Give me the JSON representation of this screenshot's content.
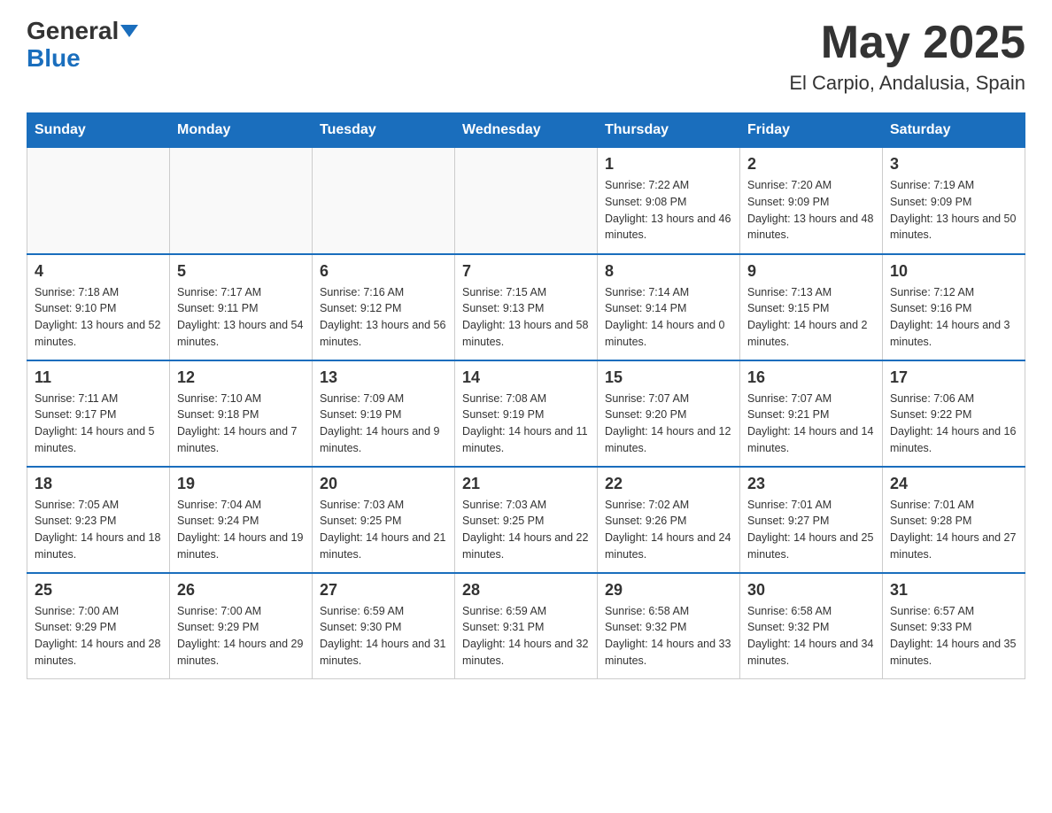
{
  "header": {
    "logo_general": "General",
    "logo_blue": "Blue",
    "month_title": "May 2025",
    "location": "El Carpio, Andalusia, Spain"
  },
  "days_of_week": [
    "Sunday",
    "Monday",
    "Tuesday",
    "Wednesday",
    "Thursday",
    "Friday",
    "Saturday"
  ],
  "weeks": [
    [
      {
        "day": "",
        "info": ""
      },
      {
        "day": "",
        "info": ""
      },
      {
        "day": "",
        "info": ""
      },
      {
        "day": "",
        "info": ""
      },
      {
        "day": "1",
        "info": "Sunrise: 7:22 AM\nSunset: 9:08 PM\nDaylight: 13 hours and 46 minutes."
      },
      {
        "day": "2",
        "info": "Sunrise: 7:20 AM\nSunset: 9:09 PM\nDaylight: 13 hours and 48 minutes."
      },
      {
        "day": "3",
        "info": "Sunrise: 7:19 AM\nSunset: 9:09 PM\nDaylight: 13 hours and 50 minutes."
      }
    ],
    [
      {
        "day": "4",
        "info": "Sunrise: 7:18 AM\nSunset: 9:10 PM\nDaylight: 13 hours and 52 minutes."
      },
      {
        "day": "5",
        "info": "Sunrise: 7:17 AM\nSunset: 9:11 PM\nDaylight: 13 hours and 54 minutes."
      },
      {
        "day": "6",
        "info": "Sunrise: 7:16 AM\nSunset: 9:12 PM\nDaylight: 13 hours and 56 minutes."
      },
      {
        "day": "7",
        "info": "Sunrise: 7:15 AM\nSunset: 9:13 PM\nDaylight: 13 hours and 58 minutes."
      },
      {
        "day": "8",
        "info": "Sunrise: 7:14 AM\nSunset: 9:14 PM\nDaylight: 14 hours and 0 minutes."
      },
      {
        "day": "9",
        "info": "Sunrise: 7:13 AM\nSunset: 9:15 PM\nDaylight: 14 hours and 2 minutes."
      },
      {
        "day": "10",
        "info": "Sunrise: 7:12 AM\nSunset: 9:16 PM\nDaylight: 14 hours and 3 minutes."
      }
    ],
    [
      {
        "day": "11",
        "info": "Sunrise: 7:11 AM\nSunset: 9:17 PM\nDaylight: 14 hours and 5 minutes."
      },
      {
        "day": "12",
        "info": "Sunrise: 7:10 AM\nSunset: 9:18 PM\nDaylight: 14 hours and 7 minutes."
      },
      {
        "day": "13",
        "info": "Sunrise: 7:09 AM\nSunset: 9:19 PM\nDaylight: 14 hours and 9 minutes."
      },
      {
        "day": "14",
        "info": "Sunrise: 7:08 AM\nSunset: 9:19 PM\nDaylight: 14 hours and 11 minutes."
      },
      {
        "day": "15",
        "info": "Sunrise: 7:07 AM\nSunset: 9:20 PM\nDaylight: 14 hours and 12 minutes."
      },
      {
        "day": "16",
        "info": "Sunrise: 7:07 AM\nSunset: 9:21 PM\nDaylight: 14 hours and 14 minutes."
      },
      {
        "day": "17",
        "info": "Sunrise: 7:06 AM\nSunset: 9:22 PM\nDaylight: 14 hours and 16 minutes."
      }
    ],
    [
      {
        "day": "18",
        "info": "Sunrise: 7:05 AM\nSunset: 9:23 PM\nDaylight: 14 hours and 18 minutes."
      },
      {
        "day": "19",
        "info": "Sunrise: 7:04 AM\nSunset: 9:24 PM\nDaylight: 14 hours and 19 minutes."
      },
      {
        "day": "20",
        "info": "Sunrise: 7:03 AM\nSunset: 9:25 PM\nDaylight: 14 hours and 21 minutes."
      },
      {
        "day": "21",
        "info": "Sunrise: 7:03 AM\nSunset: 9:25 PM\nDaylight: 14 hours and 22 minutes."
      },
      {
        "day": "22",
        "info": "Sunrise: 7:02 AM\nSunset: 9:26 PM\nDaylight: 14 hours and 24 minutes."
      },
      {
        "day": "23",
        "info": "Sunrise: 7:01 AM\nSunset: 9:27 PM\nDaylight: 14 hours and 25 minutes."
      },
      {
        "day": "24",
        "info": "Sunrise: 7:01 AM\nSunset: 9:28 PM\nDaylight: 14 hours and 27 minutes."
      }
    ],
    [
      {
        "day": "25",
        "info": "Sunrise: 7:00 AM\nSunset: 9:29 PM\nDaylight: 14 hours and 28 minutes."
      },
      {
        "day": "26",
        "info": "Sunrise: 7:00 AM\nSunset: 9:29 PM\nDaylight: 14 hours and 29 minutes."
      },
      {
        "day": "27",
        "info": "Sunrise: 6:59 AM\nSunset: 9:30 PM\nDaylight: 14 hours and 31 minutes."
      },
      {
        "day": "28",
        "info": "Sunrise: 6:59 AM\nSunset: 9:31 PM\nDaylight: 14 hours and 32 minutes."
      },
      {
        "day": "29",
        "info": "Sunrise: 6:58 AM\nSunset: 9:32 PM\nDaylight: 14 hours and 33 minutes."
      },
      {
        "day": "30",
        "info": "Sunrise: 6:58 AM\nSunset: 9:32 PM\nDaylight: 14 hours and 34 minutes."
      },
      {
        "day": "31",
        "info": "Sunrise: 6:57 AM\nSunset: 9:33 PM\nDaylight: 14 hours and 35 minutes."
      }
    ]
  ]
}
